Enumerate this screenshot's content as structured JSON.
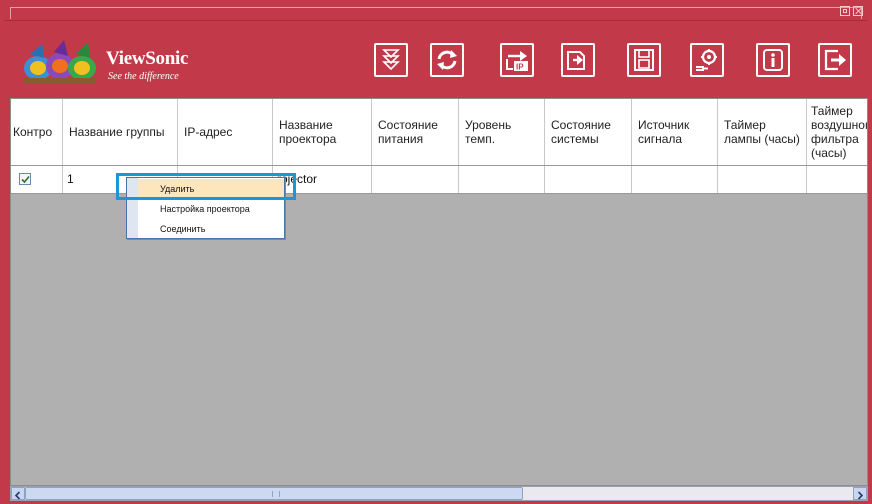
{
  "window": {
    "brand": "ViewSonic",
    "tagline": "See the difference"
  },
  "toolbar": {
    "buttons": [
      {
        "name": "download-icon"
      },
      {
        "name": "refresh-icon"
      },
      {
        "name": "ip-settings-icon"
      },
      {
        "name": "import-icon"
      },
      {
        "name": "save-icon"
      },
      {
        "name": "settings-icon"
      },
      {
        "name": "info-icon"
      },
      {
        "name": "exit-icon"
      }
    ]
  },
  "table": {
    "headers": [
      "Контро",
      "Название группы",
      "IP-адрес",
      "Название проектора",
      "Состояние питания",
      "Уровень темп.",
      "Состояние системы",
      "Источник сигнала",
      "Таймер лампы (часы)",
      "Таймер воздушного фильтра (часы)"
    ],
    "rows": [
      {
        "checked": true,
        "group": "1",
        "ip": "",
        "projector": "rojector",
        "power": "",
        "temp": "",
        "system": "",
        "source": "",
        "lamp": "",
        "filter": ""
      }
    ]
  },
  "context_menu": {
    "items": [
      "Удалить",
      "Настройка проектора",
      "Соединить"
    ],
    "active_index": 0
  },
  "colors": {
    "frame": "#c23a4a",
    "grid_bg": "#b0b0b0",
    "highlight": "#1e95d8",
    "menu_active": "#fde5bc"
  }
}
